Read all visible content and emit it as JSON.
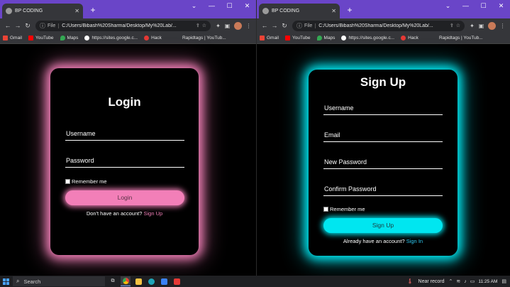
{
  "browser": {
    "tab_title": "BP CODING",
    "tab_close": "✕",
    "new_tab": "+",
    "window_controls": [
      "⌄",
      "—",
      "☐",
      "✕"
    ],
    "url_info_icon": "ⓘ",
    "url_prefix": "File",
    "url_left": "C:/Users/Bibash%20Sharma/Desktop/My%20Lab/...",
    "url_right": "C:/Users/Bibash%20Sharma/Desktop/My%20Lab/...",
    "bookmarks": [
      {
        "label": "Gmail",
        "color": "#ea4335"
      },
      {
        "label": "YouTube",
        "color": "#ff0000"
      },
      {
        "label": "Maps",
        "color": "#34a853"
      },
      {
        "label": "https://sites.google.c...",
        "color": "#ffffff"
      },
      {
        "label": "Hack",
        "color": "#e53935"
      },
      {
        "label": "Rapidtags | YouTub...",
        "color": "#35363a"
      }
    ]
  },
  "login": {
    "title": "Login",
    "username_placeholder": "Username",
    "password_placeholder": "Password",
    "remember_label": "Remember me",
    "button_label": "Login",
    "footer_text": "Don't have an account? ",
    "footer_link": "Sign Up",
    "accent": "#f27fb8"
  },
  "signup": {
    "title": "Sign Up",
    "username_placeholder": "Username",
    "email_placeholder": "Email",
    "new_password_placeholder": "New Password",
    "confirm_password_placeholder": "Confirm Password",
    "remember_label": "Remember me",
    "button_label": "Sign Up",
    "footer_text": "Already have an account? ",
    "footer_link": "Sign In",
    "accent": "#00e6f0"
  },
  "taskbar": {
    "search_label": "Search",
    "weather_text": "Near record",
    "time": "11:25 AM"
  }
}
